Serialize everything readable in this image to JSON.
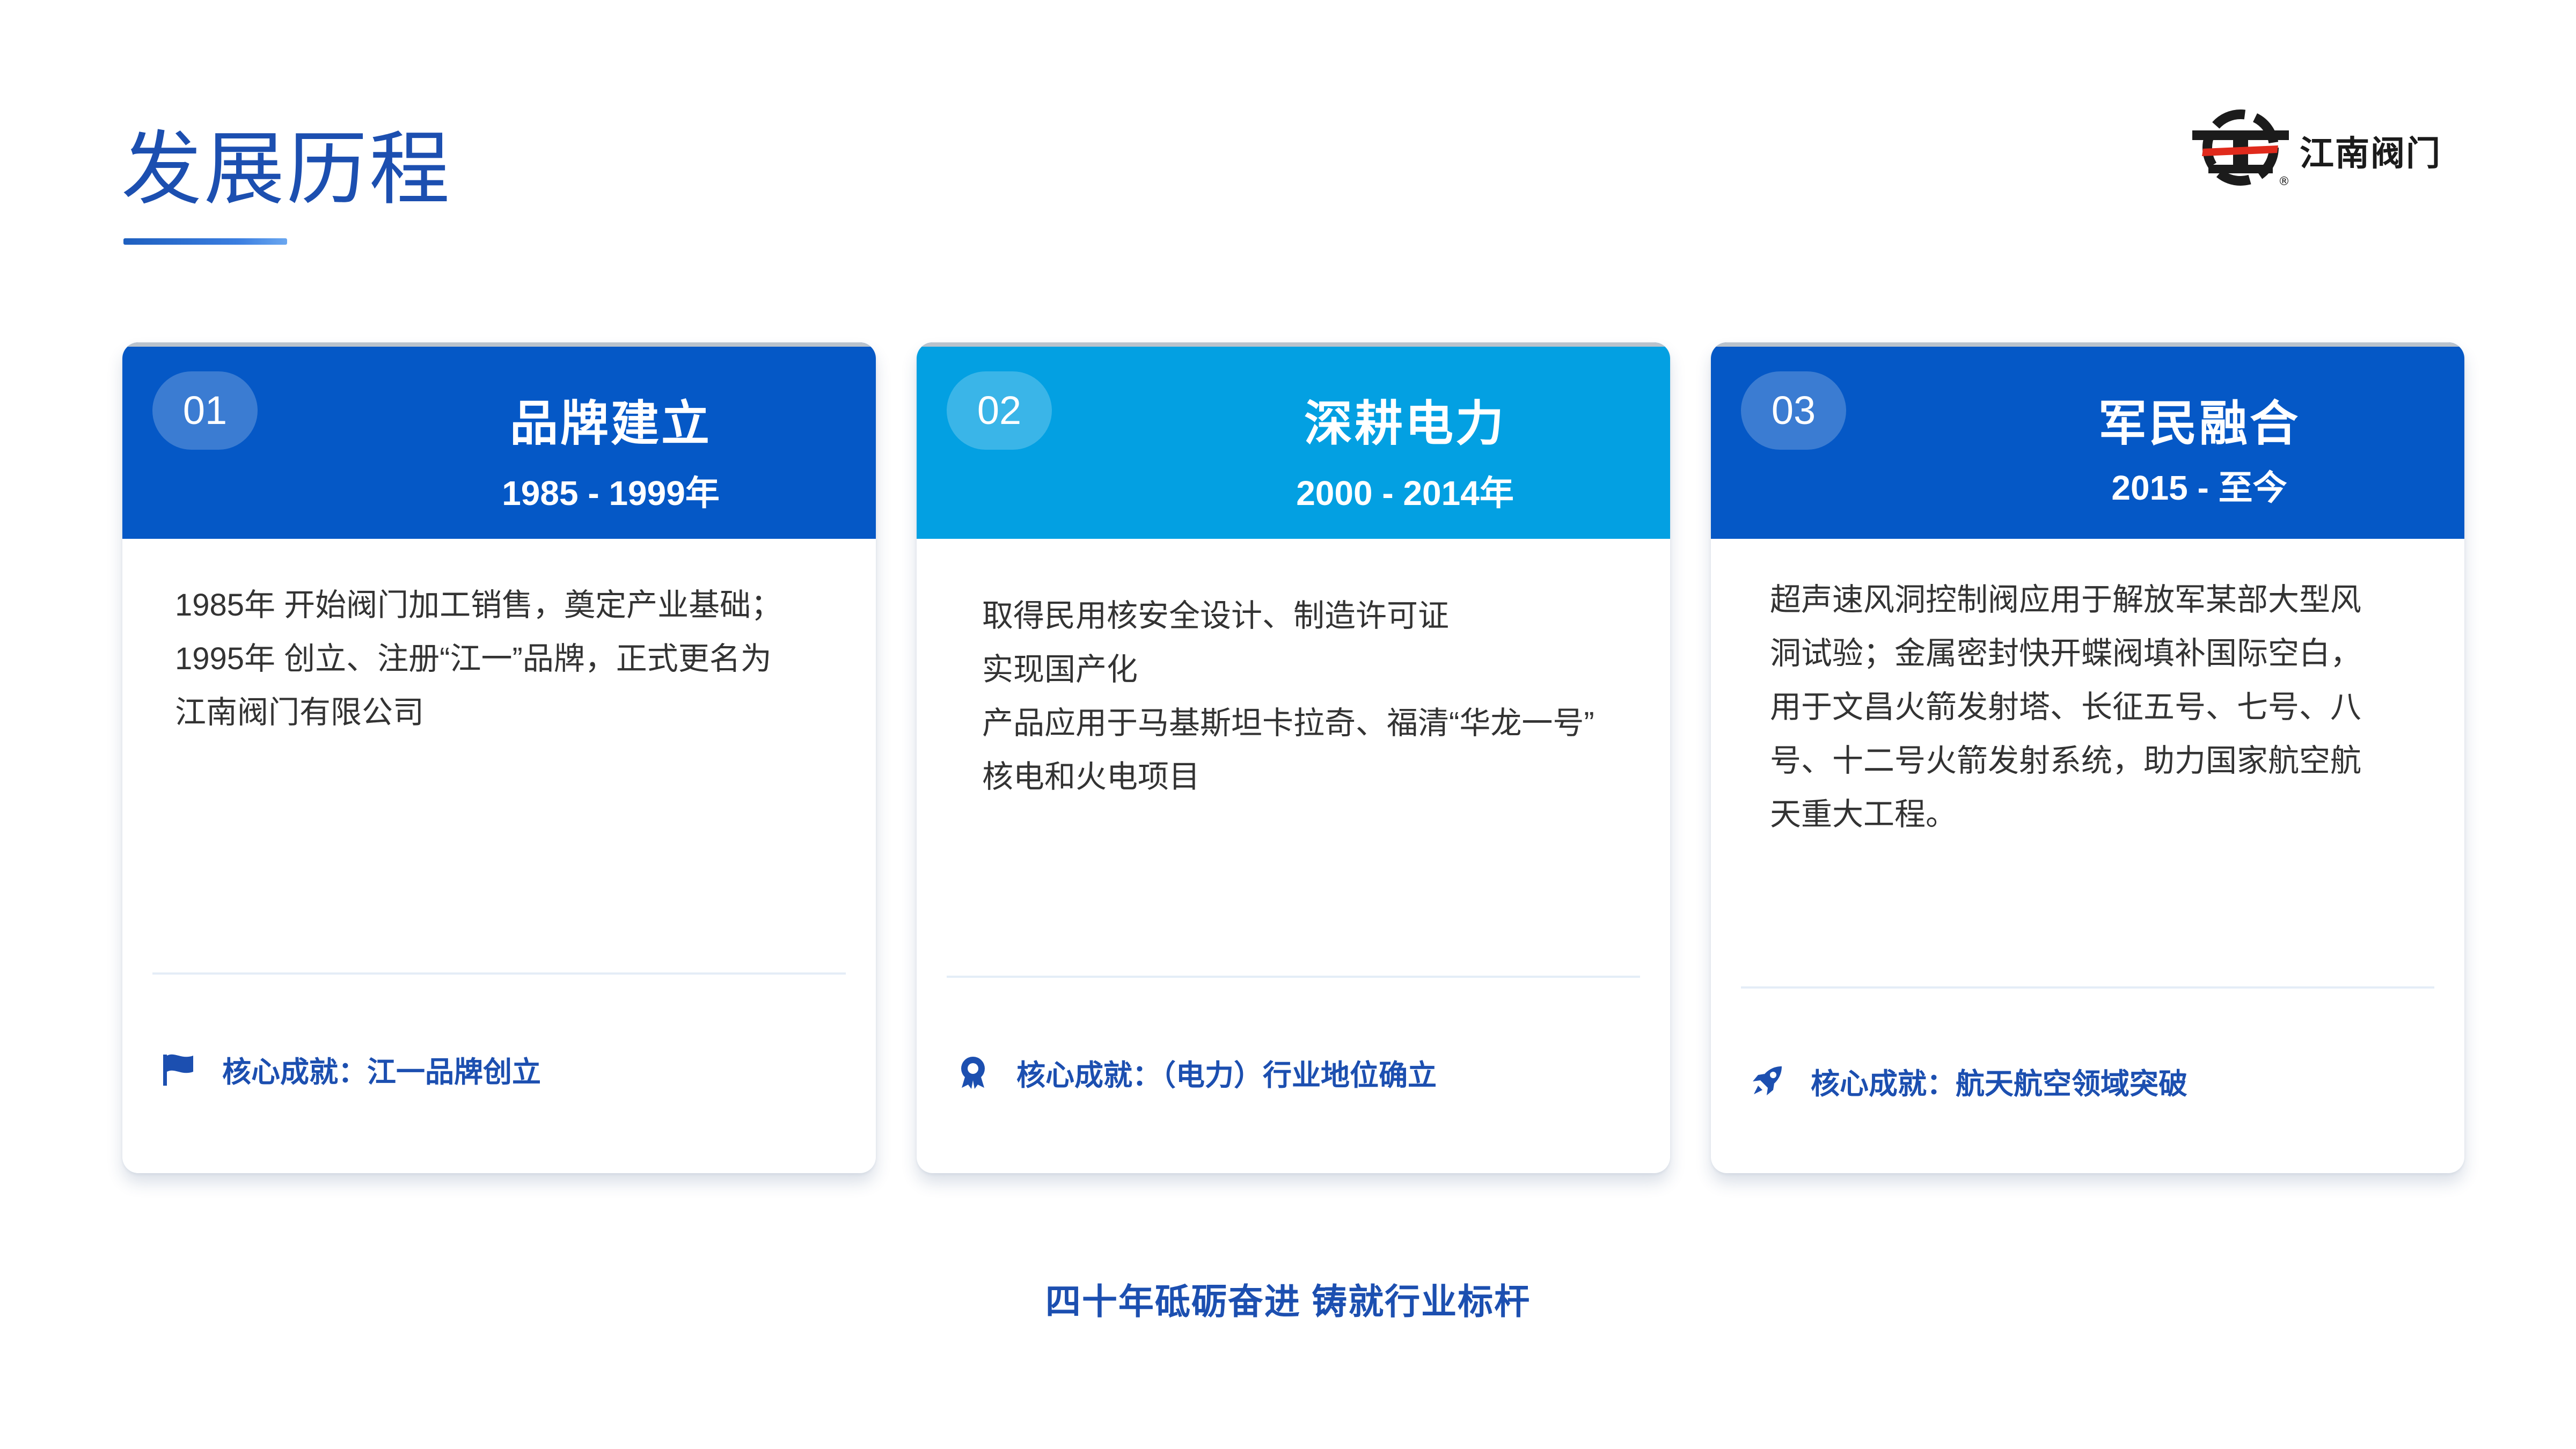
{
  "page": {
    "title": "发展历程",
    "footer": "四十年砥砺奋进 铸就行业标杆"
  },
  "logo": {
    "name": "江南阀门",
    "icon": "jiangnan-valve-logo-icon"
  },
  "colors": {
    "primary_blue": "#0558c6",
    "cyan": "#03a0e2",
    "accent_text": "#1c4fb0"
  },
  "cards": [
    {
      "number": "01",
      "title": "品牌建立",
      "years": "1985 - 1999年",
      "body": [
        "1985年 开始阀门加工销售，奠定产业基础；",
        "1995年 创立、注册“江一”品牌，正式更名为",
        "江南阀门有限公司"
      ],
      "achievement": "核心成就：江一品牌创立",
      "icon": "flag-icon"
    },
    {
      "number": "02",
      "title": "深耕电力",
      "years": "2000 - 2014年",
      "body": [
        "取得民用核安全设计、制造许可证",
        "实现国产化",
        "产品应用于马基斯坦卡拉奇、福清“华龙一号”",
        "核电和火电项目"
      ],
      "achievement": "核心成就：（电力）行业地位确立",
      "icon": "award-icon"
    },
    {
      "number": "03",
      "title": "军民融合",
      "years": "2015 - 至今",
      "body": [
        "超声速风洞控制阀应用于解放军某部大型风",
        "洞试验；金属密封快开蝶阀填补国际空白，",
        "用于文昌火箭发射塔、长征五号、七号、八",
        "号、十二号火箭发射系统，助力国家航空航",
        "天重大工程。"
      ],
      "achievement": "核心成就：航天航空领域突破",
      "icon": "rocket-icon"
    }
  ]
}
